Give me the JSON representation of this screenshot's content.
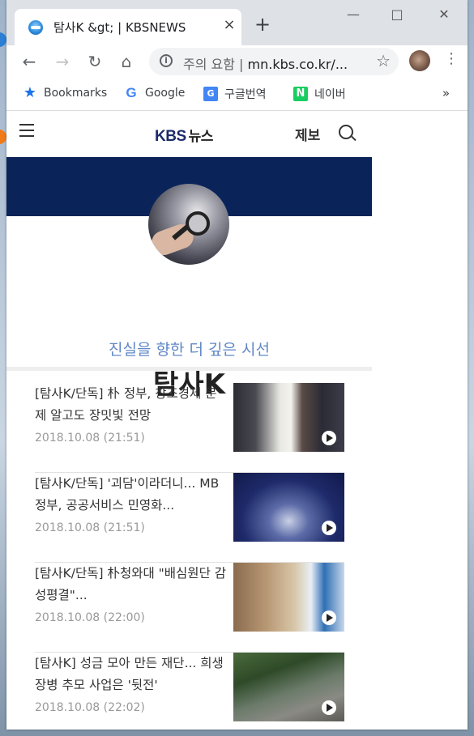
{
  "browser": {
    "tab_title": "탐사K &gt; | KBSNEWS",
    "tab_close": "×",
    "new_tab": "+",
    "omnibox_prefix": "주의 요함  |  ",
    "omnibox_url": "mn.kbs.co.kr/...",
    "bookmarks": [
      {
        "label": "Bookmarks",
        "icon": "star-icon"
      },
      {
        "label": "Google",
        "icon": "google-icon"
      },
      {
        "label": "구글번역",
        "icon": "google-translate-icon"
      },
      {
        "label": "네이버",
        "icon": "naver-icon"
      }
    ],
    "bookmarks_more": "»"
  },
  "site": {
    "logo_kbs": "KBS",
    "logo_news": "뉴스",
    "report_label": "제보"
  },
  "hero": {
    "tagline": "진실을 향한 더 깊은 시선",
    "title": "탐사K"
  },
  "articles": [
    {
      "title": "[탐사K/단독] 朴 정부, 창조경제 문제 알고도 장밋빛 전망",
      "date": "2018.10.08 (21:51)"
    },
    {
      "title": "[탐사K/단독] '괴담'이라더니... MB 정부, 공공서비스 민영화...",
      "date": "2018.10.08 (21:51)"
    },
    {
      "title": "[탐사K/단독] 朴청와대 \"배심원단 감성평결\"...",
      "date": "2018.10.08 (22:00)"
    },
    {
      "title": "[탐사K] 성금 모아 만든 재단... 희생장병 추모 사업은 '뒷전'",
      "date": "2018.10.08 (22:02)"
    }
  ],
  "colors": {
    "banner": "#0a2459",
    "tagline": "#5f87c6",
    "logo": "#1d2b6b"
  }
}
